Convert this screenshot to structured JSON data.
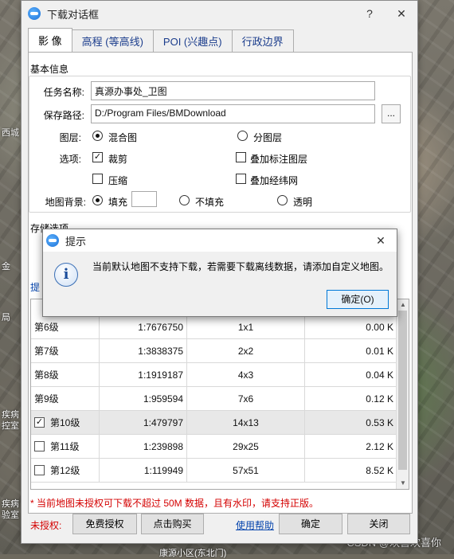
{
  "map": {
    "labels": [
      "西城",
      "金",
      "局",
      "疾病",
      "控室",
      "疾病",
      "验室",
      "康源小区(东北门)"
    ],
    "watermark": "CSDN @欢喜欢喜你"
  },
  "dialog": {
    "title": "下载对话框",
    "help_btn": "?",
    "close_btn": "✕",
    "tabs": [
      "影 像",
      "高程 (等高线)",
      "POI (兴趣点)",
      "行政边界"
    ],
    "basic_info_label": "基本信息",
    "task_name_label": "任务名称:",
    "task_name_value": "真源办事处_卫图",
    "save_path_label": "保存路径:",
    "save_path_value": "D:/Program Files/BMDownload",
    "browse_btn": "...",
    "layer_label": "图层:",
    "layer_opt1": "混合图",
    "layer_opt2": "分图层",
    "options_label": "选项:",
    "opt_crop": "裁剪",
    "opt_overlay_labels": "叠加标注图层",
    "opt_compress": "压缩",
    "opt_overlay_grid": "叠加经纬网",
    "bg_label": "地图背景:",
    "bg_fill": "填充",
    "bg_nofill": "不填充",
    "bg_transparent": "透明",
    "storage_label": "存储选项",
    "hint_prefix": "提",
    "levels": [
      {
        "level": "第6级",
        "scale": "1:7676750",
        "tiles": "1x1",
        "size": "0.00 K",
        "check": false
      },
      {
        "level": "第7级",
        "scale": "1:3838375",
        "tiles": "2x2",
        "size": "0.01 K",
        "check": false
      },
      {
        "level": "第8级",
        "scale": "1:1919187",
        "tiles": "4x3",
        "size": "0.04 K",
        "check": false
      },
      {
        "level": "第9级",
        "scale": "1:959594",
        "tiles": "7x6",
        "size": "0.12 K",
        "check": false
      },
      {
        "level": "第10级",
        "scale": "1:479797",
        "tiles": "14x13",
        "size": "0.53 K",
        "check": true
      },
      {
        "level": "第11级",
        "scale": "1:239898",
        "tiles": "29x25",
        "size": "2.12 K",
        "check": false
      },
      {
        "level": "第12级",
        "scale": "1:119949",
        "tiles": "57x51",
        "size": "8.52 K",
        "check": false
      }
    ],
    "notice": "* 当前地图未授权可下载不超过 50M 数据，且有水印，请支持正版。",
    "unauth_label": "未授权:",
    "free_auth_btn": "免费授权",
    "buy_btn": "点击购买",
    "help_link": "使用帮助",
    "ok_btn": "确定",
    "close_label": "关闭"
  },
  "hint_dialog": {
    "title": "提示",
    "close_btn": "✕",
    "message": "当前默认地图不支持下载，若需要下载离线数据，请添加自定义地图。",
    "ok_btn": "确定(O)"
  },
  "colors": {
    "notice_red": "#d40000",
    "link_blue": "#0645ad",
    "accent": "#0078d7"
  }
}
